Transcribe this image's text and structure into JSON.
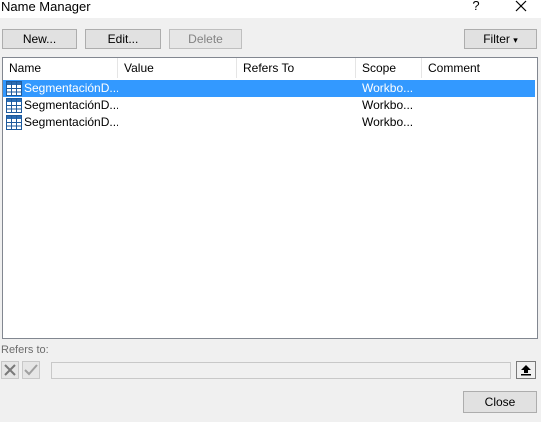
{
  "window": {
    "title": "Name Manager",
    "help_glyph": "?"
  },
  "toolbar": {
    "new_label": "New...",
    "edit_label": "Edit...",
    "delete_label": "Delete",
    "filter_label": "Filter",
    "filter_glyph": "▾"
  },
  "table": {
    "columns": [
      "Name",
      "Value",
      "Refers To",
      "Scope",
      "Comment"
    ],
    "rows": [
      {
        "name": "SegmentaciónD...",
        "value": "",
        "refers_to": "",
        "scope": "Workbo...",
        "comment": "",
        "selected": true
      },
      {
        "name": "SegmentaciónD...",
        "value": "",
        "refers_to": "",
        "scope": "Workbo...",
        "comment": "",
        "selected": false
      },
      {
        "name": "SegmentaciónD...",
        "value": "",
        "refers_to": "",
        "scope": "Workbo...",
        "comment": "",
        "selected": false
      }
    ]
  },
  "refers_to": {
    "label": "Refers to:",
    "value": ""
  },
  "footer": {
    "close_label": "Close"
  },
  "colors": {
    "selection": "#3399ff",
    "dialog_bg": "#f0f0f0"
  },
  "icons": [
    "help-icon",
    "close-icon",
    "table-icon",
    "cancel-x-icon",
    "check-icon",
    "collapse-dialog-icon"
  ]
}
